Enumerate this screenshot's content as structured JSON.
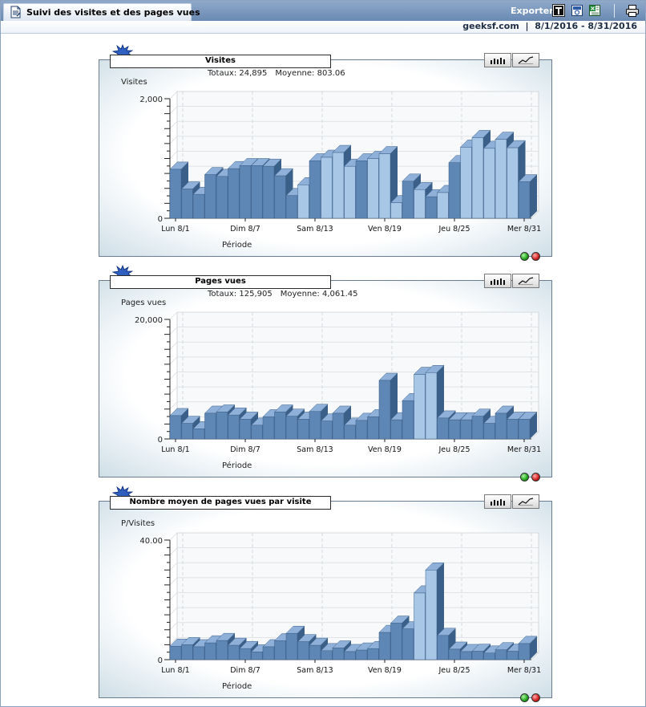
{
  "header": {
    "title": "Suivi des visites et des pages vues",
    "export_label": "Exporter",
    "site": "geeksf.com",
    "separator": "|",
    "date_range": "8/1/2016 - 8/31/2016",
    "icons": [
      "document-icon",
      "export-text-icon",
      "export-word-icon",
      "export-excel-icon",
      "print-icon"
    ]
  },
  "panels": [
    {
      "title": "Visites",
      "totals_label": "Totaux:",
      "totals_value": "24,895",
      "avg_label": "Moyenne:",
      "avg_value": "803.06",
      "ylabel": "Visites",
      "xlabel": "Période"
    },
    {
      "title": "Pages vues",
      "totals_label": "Totaux:",
      "totals_value": "125,905",
      "avg_label": "Moyenne:",
      "avg_value": "4,061.45",
      "ylabel": "Pages vues",
      "xlabel": "Période"
    },
    {
      "title": "Nombre moyen de pages vues par visite",
      "ylabel": "P/Visites",
      "xlabel": "Période"
    }
  ],
  "colors": {
    "header_blue": "#6a8ab3",
    "bar_front": "#5f87b5",
    "bar_front_light": "#a8c6e6",
    "bar_side": "#3a5f88",
    "bar_top": "#8fb0d8"
  },
  "chart_data": [
    {
      "type": "bar",
      "title": "Visites",
      "ylabel": "Visites",
      "xlabel": "Période",
      "ylim": [
        0,
        2000
      ],
      "yticks": [
        0,
        2000
      ],
      "ytick_labels": [
        "0",
        "2,000"
      ],
      "x_labels": [
        "Lun 8/1",
        "Dim 8/7",
        "Sam 8/13",
        "Ven 8/19",
        "Jeu 8/25",
        "Mer 8/31"
      ],
      "x_label_days": [
        1,
        7,
        13,
        19,
        25,
        31
      ],
      "days": [
        1,
        2,
        3,
        4,
        5,
        6,
        7,
        8,
        9,
        10,
        11,
        12,
        13,
        14,
        15,
        16,
        17,
        18,
        19,
        20,
        21,
        22,
        23,
        24,
        25,
        26,
        27,
        28,
        29,
        30,
        31
      ],
      "values": [
        820,
        490,
        400,
        730,
        700,
        830,
        880,
        880,
        870,
        710,
        380,
        560,
        960,
        1020,
        1100,
        870,
        960,
        1000,
        1080,
        260,
        620,
        480,
        360,
        430,
        930,
        1190,
        1350,
        1170,
        1320,
        1180,
        610
      ]
    },
    {
      "type": "bar",
      "title": "Pages vues",
      "ylabel": "Pages vues",
      "xlabel": "Période",
      "ylim": [
        0,
        20000
      ],
      "yticks": [
        0,
        20000
      ],
      "ytick_labels": [
        "0",
        "20,000"
      ],
      "x_labels": [
        "Lun 8/1",
        "Dim 8/7",
        "Sam 8/13",
        "Ven 8/19",
        "Jeu 8/25",
        "Mer 8/31"
      ],
      "x_label_days": [
        1,
        7,
        13,
        19,
        25,
        31
      ],
      "days": [
        1,
        2,
        3,
        4,
        5,
        6,
        7,
        8,
        9,
        10,
        11,
        12,
        13,
        14,
        15,
        16,
        17,
        18,
        19,
        20,
        21,
        22,
        23,
        24,
        25,
        26,
        27,
        28,
        29,
        30,
        31
      ],
      "values": [
        3900,
        2600,
        1700,
        4300,
        4500,
        4000,
        3300,
        2300,
        3700,
        4500,
        3800,
        3300,
        4600,
        3000,
        4300,
        2300,
        3100,
        3700,
        9800,
        3200,
        6400,
        10800,
        11100,
        3500,
        3200,
        3200,
        3800,
        2600,
        4300,
        3300,
        3300
      ]
    },
    {
      "type": "bar",
      "title": "Nombre moyen de pages vues par visite",
      "ylabel": "P/Visites",
      "xlabel": "Période",
      "ylim": [
        0,
        40
      ],
      "yticks": [
        0,
        40
      ],
      "ytick_labels": [
        "0",
        "40.00"
      ],
      "x_labels": [
        "Lun 8/1",
        "Dim 8/7",
        "Sam 8/13",
        "Ven 8/19",
        "Jeu 8/25",
        "Mer 8/31"
      ],
      "x_label_days": [
        1,
        7,
        13,
        19,
        25,
        31
      ],
      "days": [
        1,
        2,
        3,
        4,
        5,
        6,
        7,
        8,
        9,
        10,
        11,
        12,
        13,
        14,
        15,
        16,
        17,
        18,
        19,
        20,
        21,
        22,
        23,
        24,
        25,
        26,
        27,
        28,
        29,
        30,
        31
      ],
      "values": [
        4.5,
        5.0,
        4.3,
        5.6,
        6.4,
        4.8,
        3.7,
        2.6,
        4.3,
        6.3,
        8.8,
        6.0,
        4.8,
        3.0,
        3.9,
        2.7,
        3.2,
        3.7,
        9.1,
        12.2,
        10.3,
        22.3,
        30.0,
        8.1,
        3.5,
        2.7,
        2.8,
        2.2,
        3.3,
        2.8,
        5.4
      ]
    }
  ]
}
